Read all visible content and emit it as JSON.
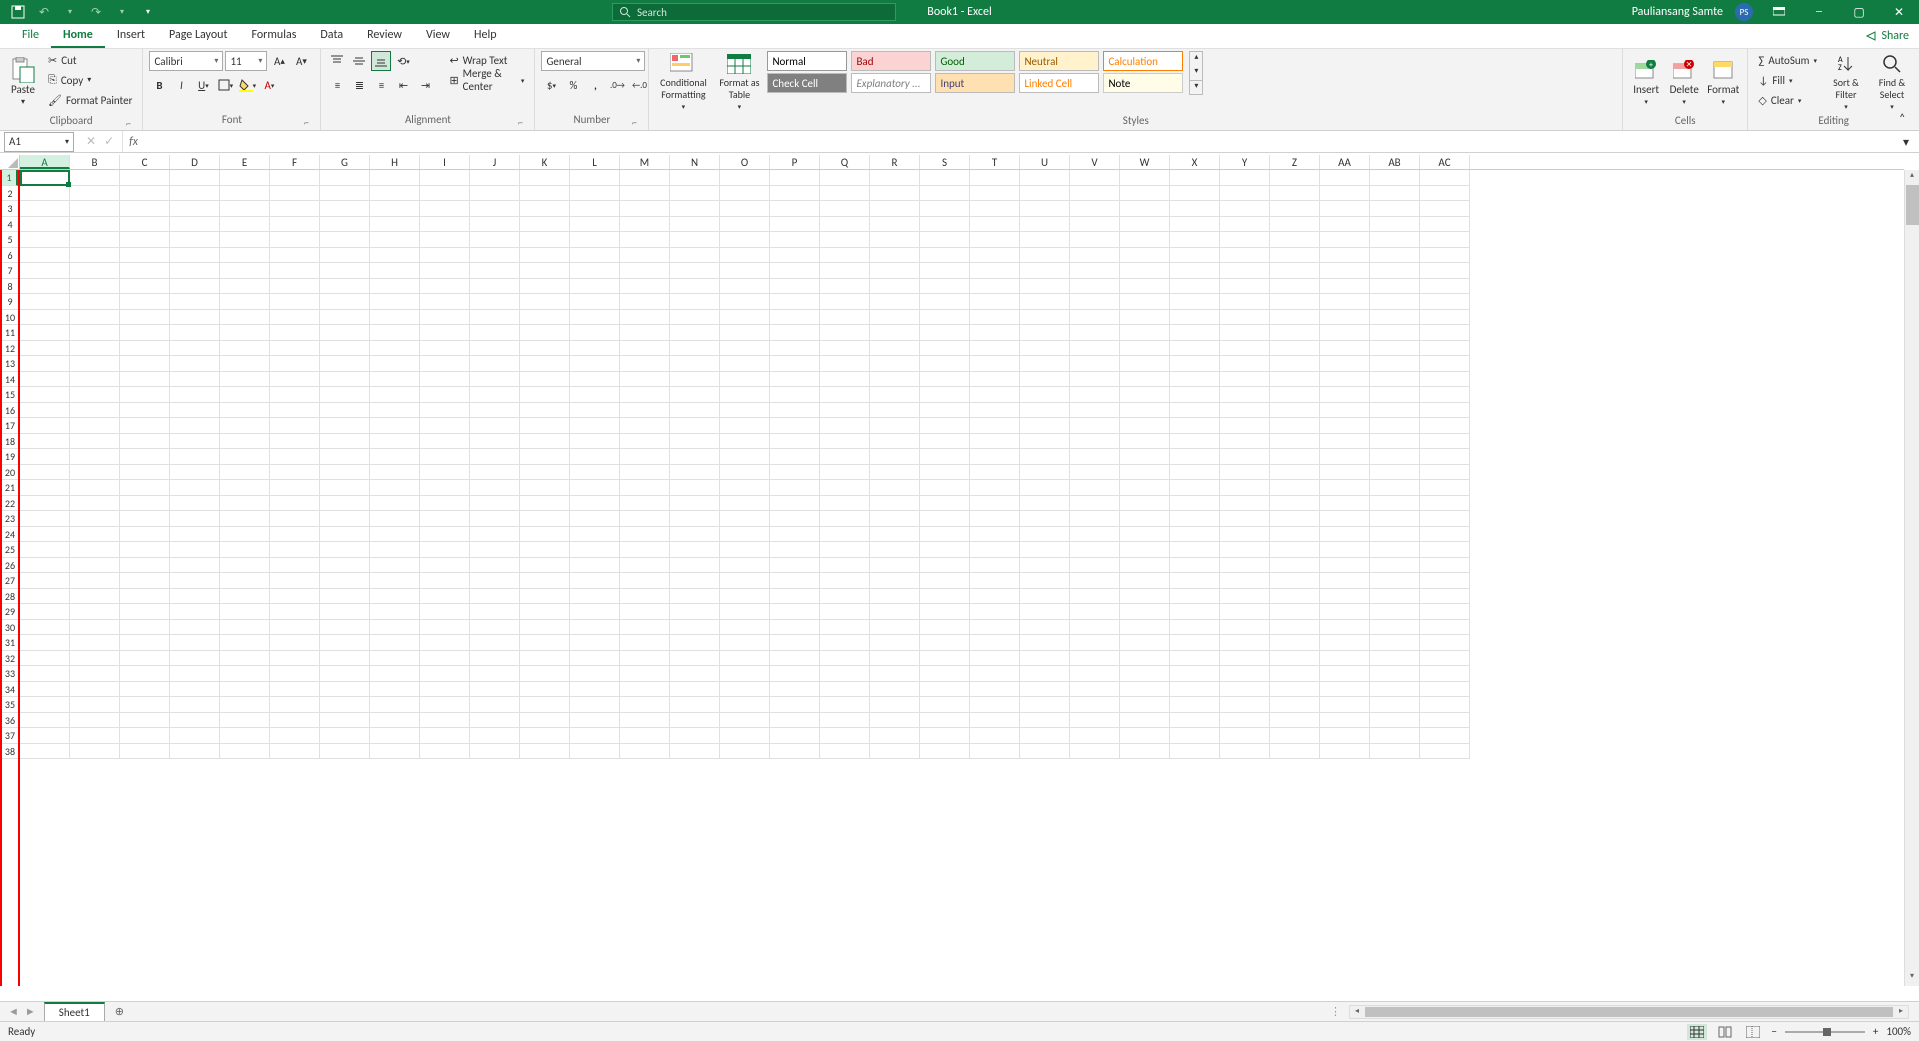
{
  "title": "Book1 - Excel",
  "search_placeholder": "Search",
  "user": {
    "name": "Pauliansang Samte",
    "initials": "PS"
  },
  "tabs": [
    "File",
    "Home",
    "Insert",
    "Page Layout",
    "Formulas",
    "Data",
    "Review",
    "View",
    "Help"
  ],
  "active_tab": "Home",
  "share_label": "Share",
  "clipboard": {
    "paste": "Paste",
    "cut": "Cut",
    "copy": "Copy",
    "format_painter": "Format Painter",
    "group": "Clipboard"
  },
  "font": {
    "name": "Calibri",
    "size": "11",
    "group": "Font"
  },
  "alignment": {
    "wrap": "Wrap Text",
    "merge": "Merge & Center",
    "group": "Alignment"
  },
  "number": {
    "format": "General",
    "group": "Number"
  },
  "styles": {
    "conditional": "Conditional Formatting",
    "format_table": "Format as Table",
    "cells": [
      {
        "label": "Normal",
        "bg": "#fff",
        "color": "#000",
        "border": "1px solid #999"
      },
      {
        "label": "Bad",
        "bg": "#fcd3d3",
        "color": "#9c0006"
      },
      {
        "label": "Good",
        "bg": "#d4edda",
        "color": "#006100"
      },
      {
        "label": "Neutral",
        "bg": "#fff2cc",
        "color": "#9c5700"
      },
      {
        "label": "Calculation",
        "bg": "#fff",
        "color": "#ff7f00",
        "border": "1px solid #ff7f00"
      },
      {
        "label": "Check Cell",
        "bg": "#808080",
        "color": "#fff"
      },
      {
        "label": "Explanatory ...",
        "bg": "#fff",
        "color": "#7f7f7f",
        "italic": true
      },
      {
        "label": "Input",
        "bg": "#ffe0b0",
        "color": "#3f3f76"
      },
      {
        "label": "Linked Cell",
        "bg": "#fff",
        "color": "#ff7f00"
      },
      {
        "label": "Note",
        "bg": "#fffde7",
        "color": "#000",
        "border": "1px solid #ccc"
      }
    ],
    "group": "Styles"
  },
  "cells_group": {
    "insert": "Insert",
    "delete": "Delete",
    "format": "Format",
    "group": "Cells"
  },
  "editing": {
    "autosum": "AutoSum",
    "fill": "Fill",
    "clear": "Clear",
    "sort": "Sort & Filter",
    "find": "Find & Select",
    "group": "Editing"
  },
  "name_box": "A1",
  "columns": [
    "A",
    "B",
    "C",
    "D",
    "E",
    "F",
    "G",
    "H",
    "I",
    "J",
    "K",
    "L",
    "M",
    "N",
    "O",
    "P",
    "Q",
    "R",
    "S",
    "T",
    "U",
    "V",
    "W",
    "X",
    "Y",
    "Z",
    "AA",
    "AB",
    "AC"
  ],
  "row_count": 38,
  "active_cell": {
    "col": 0,
    "row": 0
  },
  "sheet_tabs": [
    "Sheet1"
  ],
  "status": "Ready",
  "zoom": "100%"
}
